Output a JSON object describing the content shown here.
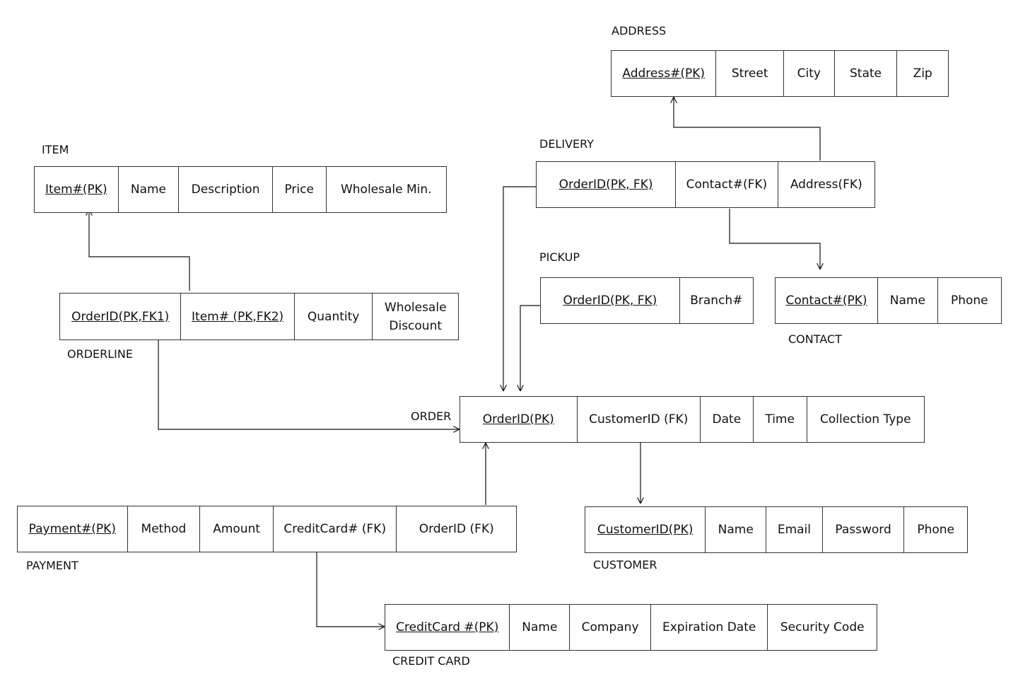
{
  "entities": [
    {
      "name": "ADDRESS",
      "fields": [
        {
          "text": "Address#(PK)",
          "pk": true
        },
        {
          "text": "Street"
        },
        {
          "text": "City"
        },
        {
          "text": "State"
        },
        {
          "text": "Zip"
        }
      ]
    },
    {
      "name": "ITEM",
      "fields": [
        {
          "text": "Item#(PK)",
          "pk": true
        },
        {
          "text": "Name"
        },
        {
          "text": "Description"
        },
        {
          "text": "Price"
        },
        {
          "text": "Wholesale Min."
        }
      ]
    },
    {
      "name": "DELIVERY",
      "fields": [
        {
          "text": "OrderID(PK, FK)",
          "pk": true
        },
        {
          "text": "Contact#(FK)"
        },
        {
          "text": "Address(FK)"
        }
      ]
    },
    {
      "name": "PICKUP",
      "fields": [
        {
          "text": "OrderID(PK, FK)",
          "pk": true
        },
        {
          "text": "Branch#"
        }
      ]
    },
    {
      "name": "CONTACT",
      "fields": [
        {
          "text": "Contact#(PK)",
          "pk": true
        },
        {
          "text": "Name"
        },
        {
          "text": "Phone"
        }
      ]
    },
    {
      "name": "ORDERLINE",
      "fields": [
        {
          "text": "OrderID(PK,FK1)",
          "pk": true
        },
        {
          "text": "Item# (PK,FK2)",
          "pk": true
        },
        {
          "text": "Quantity"
        },
        {
          "text": "Wholesale\nDiscount"
        }
      ]
    },
    {
      "name": "ORDER",
      "fields": [
        {
          "text": "OrderID(PK)",
          "pk": true
        },
        {
          "text": "CustomerID (FK)"
        },
        {
          "text": "Date"
        },
        {
          "text": "Time"
        },
        {
          "text": "Collection Type"
        }
      ]
    },
    {
      "name": "PAYMENT",
      "fields": [
        {
          "text": "Payment#(PK)",
          "pk": true
        },
        {
          "text": "Method"
        },
        {
          "text": "Amount"
        },
        {
          "text": "CreditCard# (FK)"
        },
        {
          "text": "OrderID (FK)"
        }
      ]
    },
    {
      "name": "CUSTOMER",
      "fields": [
        {
          "text": "CustomerID(PK)",
          "pk": true
        },
        {
          "text": "Name"
        },
        {
          "text": "Email"
        },
        {
          "text": "Password"
        },
        {
          "text": "Phone"
        }
      ]
    },
    {
      "name": "CREDIT CARD",
      "fields": [
        {
          "text": "CreditCard #(PK)",
          "pk": true
        },
        {
          "text": "Name"
        },
        {
          "text": "Company"
        },
        {
          "text": "Expiration Date"
        },
        {
          "text": "Security Code"
        }
      ]
    }
  ],
  "relationships": [
    {
      "from": "DELIVERY.Address(FK)",
      "to": "ADDRESS.Address#(PK)"
    },
    {
      "from": "DELIVERY.Contact#(FK)",
      "to": "CONTACT.Contact#(PK)"
    },
    {
      "from": "DELIVERY.OrderID(PK, FK)",
      "to": "ORDER.OrderID(PK)"
    },
    {
      "from": "PICKUP.OrderID(PK, FK)",
      "to": "ORDER.OrderID(PK)"
    },
    {
      "from": "ORDERLINE.Item# (PK,FK2)",
      "to": "ITEM.Item#(PK)"
    },
    {
      "from": "ORDERLINE.OrderID(PK,FK1)",
      "to": "ORDER.OrderID(PK)"
    },
    {
      "from": "PAYMENT.OrderID (FK)",
      "to": "ORDER.OrderID(PK)"
    },
    {
      "from": "ORDER.CustomerID (FK)",
      "to": "CUSTOMER.CustomerID(PK)"
    },
    {
      "from": "PAYMENT.CreditCard# (FK)",
      "to": "CREDIT CARD.CreditCard #(PK)"
    }
  ]
}
